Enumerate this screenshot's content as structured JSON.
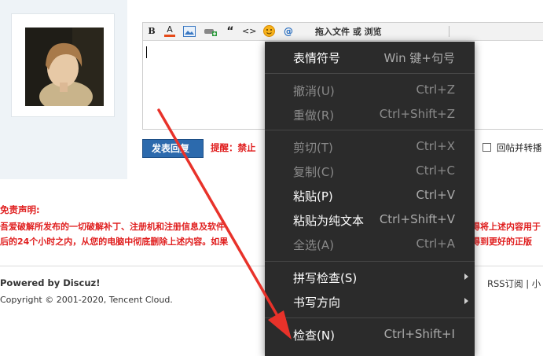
{
  "toolbar": {
    "bold": "B",
    "font_color": "A",
    "quote": "“",
    "code": "<>",
    "at": "@",
    "upload_label": "拖入文件 或 浏览"
  },
  "reply": {
    "submit_label": "发表回复",
    "tip": "提醒：禁止",
    "also_post_label": "回帖并转播"
  },
  "disclaimer": {
    "title": "免责声明:",
    "line1": "吾爱破解所发布的一切破解补丁、注册机和注册信息及软件",
    "line1_tail": "得将上述内容用于",
    "line2": "后的24个小时之内，从您的电脑中彻底删除上述内容。如果",
    "line2_tail": "得到更好的正版"
  },
  "footer": {
    "powered": "Powered by Discuz!",
    "copyright": "Copyright © 2001-2020, Tencent Cloud.",
    "rss": "RSS订阅 | 小"
  },
  "context_menu": {
    "items": [
      {
        "label": "表情符号",
        "shortcut": "Win 键+句号",
        "enabled": true
      },
      {
        "label": "撤消(U)",
        "shortcut": "Ctrl+Z",
        "enabled": false
      },
      {
        "label": "重做(R)",
        "shortcut": "Ctrl+Shift+Z",
        "enabled": false
      },
      {
        "label": "剪切(T)",
        "shortcut": "Ctrl+X",
        "enabled": false
      },
      {
        "label": "复制(C)",
        "shortcut": "Ctrl+C",
        "enabled": false
      },
      {
        "label": "粘贴(P)",
        "shortcut": "Ctrl+V",
        "enabled": true
      },
      {
        "label": "粘贴为纯文本",
        "shortcut": "Ctrl+Shift+V",
        "enabled": true
      },
      {
        "label": "全选(A)",
        "shortcut": "Ctrl+A",
        "enabled": false
      },
      {
        "label": "拼写检查(S)",
        "shortcut": "",
        "enabled": true
      },
      {
        "label": "书写方向",
        "shortcut": "",
        "enabled": true
      },
      {
        "label": "检查(N)",
        "shortcut": "Ctrl+Shift+I",
        "enabled": true
      }
    ]
  },
  "colors": {
    "menu_bg": "#2b2b2b",
    "warning_red": "#e01f1f",
    "button_blue": "#2c6aad",
    "annotation_arrow": "#e8322a"
  },
  "icons": [
    "bold-icon",
    "font-color-icon",
    "image-icon",
    "attach-icon",
    "quote-icon",
    "code-icon",
    "smiley-icon",
    "at-icon"
  ]
}
